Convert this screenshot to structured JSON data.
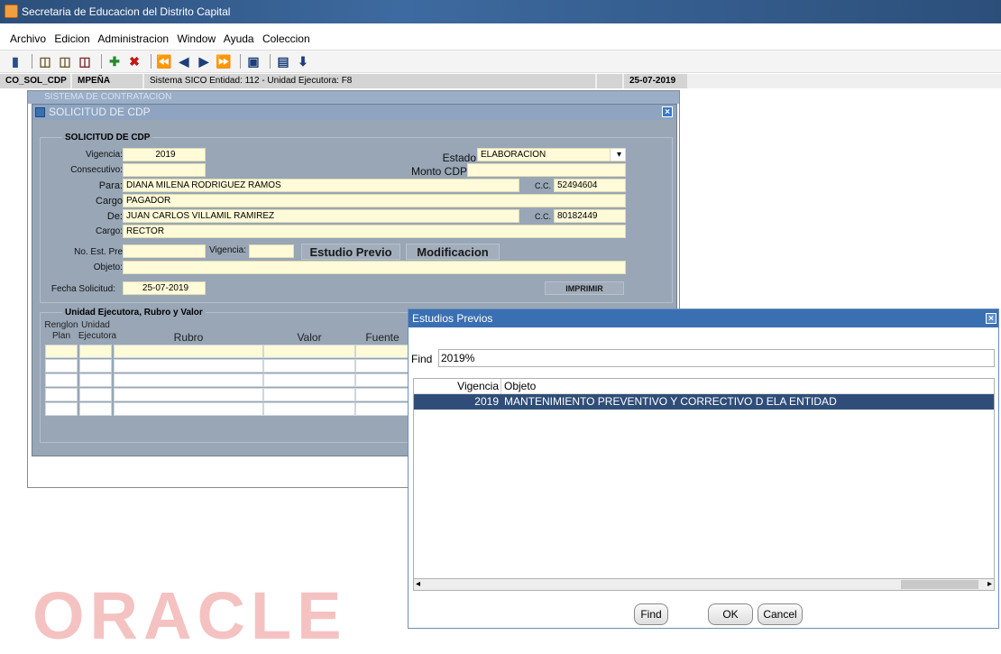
{
  "window": {
    "title": "Secretaria de Educacion del Distrito Capital"
  },
  "menu": [
    "Archivo",
    "Edicion",
    "Administracion",
    "Window",
    "Ayuda",
    "Coleccion"
  ],
  "toolbar": {
    "icons": [
      "exit-icon",
      "open-icon",
      "print-form-icon",
      "clear-icon",
      "insert-record-icon",
      "delete-record-icon",
      "first-record-icon",
      "previous-record-icon",
      "next-record-icon",
      "last-record-icon",
      "save-icon",
      "list-icon",
      "download-icon"
    ]
  },
  "status": {
    "form_name": "CO_SOL_CDP",
    "user": "MPEÑA",
    "info": "Sistema SICO  Entidad: 112 - Unidad Ejecutora: F8",
    "date": "25-07-2019"
  },
  "bg_window": {
    "title": "SISTEMA DE CONTRATACION"
  },
  "form": {
    "title": "SOLICITUD DE CDP",
    "group_title": "SOLICITUD DE CDP",
    "labels": {
      "vigencia": "Vigencia:",
      "consecutivo": "Consecutivo:",
      "para": "Para:",
      "cargo1": "Cargo",
      "de": "De:",
      "cargo2": "Cargo:",
      "estado": "Estado",
      "monto": "Monto CDP",
      "cc1": "C.C.",
      "cc2": "C.C.",
      "no_est": "No. Est. Pre",
      "vigencia2": "Vigencia:",
      "objeto": "Objeto:",
      "fecha": "Fecha Solicitud:"
    },
    "values": {
      "vigencia": "2019",
      "consecutivo": "",
      "para": "DIANA MILENA RODRIGUEZ RAMOS",
      "cargo1": "PAGADOR",
      "de": "JUAN CARLOS VILLAMIL RAMIREZ",
      "cargo2": "RECTOR",
      "estado": "ELABORACION",
      "monto": "",
      "cc1": "52494604",
      "cc2": "80182449",
      "no_est": "",
      "vigencia2": "",
      "objeto": "",
      "fecha": "25-07-2019"
    },
    "buttons": {
      "estudio": "Estudio Previo",
      "modificacion": "Modificacion",
      "imprimir": "IMPRIMIR"
    },
    "section2": {
      "title": "Unidad Ejecutora, Rubro y Valor",
      "headers": {
        "renglon": "Renglon",
        "plan": "Plan",
        "unidad": "Unidad",
        "ejecutora": "Ejecutora",
        "rubro": "Rubro",
        "valor": "Valor",
        "fuente": "Fuente"
      }
    }
  },
  "watermark": "ORACLE",
  "dialog": {
    "title": "Estudios Previos",
    "find_label": "Find",
    "find_value": "2019%",
    "columns": [
      "Vigencia",
      "Objeto"
    ],
    "rows": [
      {
        "vigencia": "2019",
        "objeto": "MANTENIMIENTO PREVENTIVO Y CORRECTIVO D ELA ENTIDAD"
      }
    ],
    "buttons": {
      "find": "Find",
      "ok": "OK",
      "cancel": "Cancel"
    }
  }
}
